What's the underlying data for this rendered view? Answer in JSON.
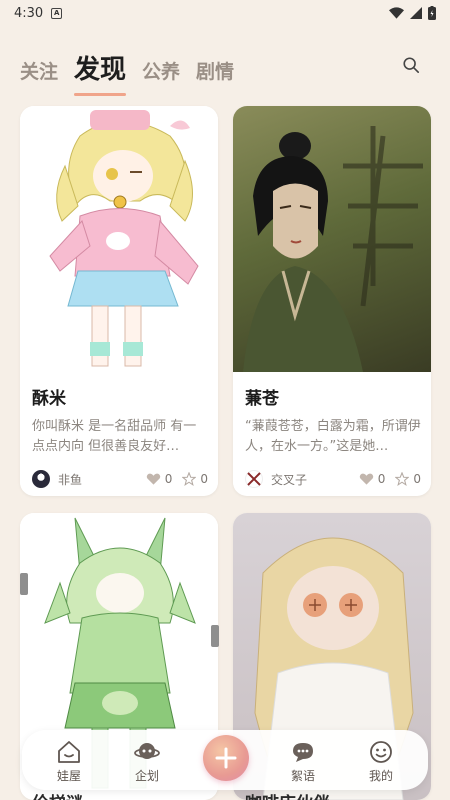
{
  "status": {
    "time": "4:30"
  },
  "tabs": [
    {
      "label": "关注",
      "active": false
    },
    {
      "label": "发现",
      "active": true
    },
    {
      "label": "公养",
      "active": false
    },
    {
      "label": "剧情",
      "active": false
    }
  ],
  "cards": [
    {
      "title": "酥米",
      "desc": "你叫酥米 是一名甜品师 有一点点内向 但很善良友好…",
      "author": "非鱼",
      "likes": "0",
      "stars": "0"
    },
    {
      "title": "蒹苍",
      "desc": "“蒹葭苍苍，白露为霜，所谓伊人，在水一方。”这是她…",
      "author": "交叉子",
      "likes": "0",
      "stars": "0"
    }
  ],
  "cut_titles": [
    "伦梯谜",
    "咖啡店伙伴"
  ],
  "nav": {
    "items": [
      {
        "label": "娃屋",
        "icon": "house-icon"
      },
      {
        "label": "企划",
        "icon": "planet-icon"
      },
      {
        "label": "絮语",
        "icon": "chat-bubble-icon"
      },
      {
        "label": "我的",
        "icon": "smiley-icon"
      }
    ],
    "fab_icon": "plus-icon"
  },
  "colors": {
    "background": "#f6efe7",
    "tab_indicator": "#f0a48a",
    "fab": "#e89a93"
  }
}
